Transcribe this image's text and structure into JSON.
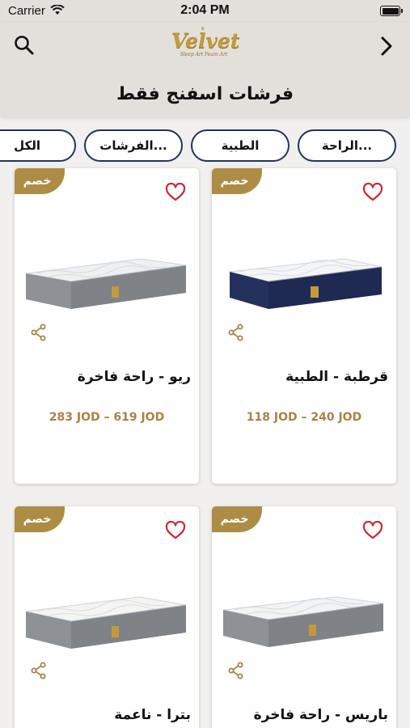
{
  "status_bar": {
    "carrier": "Carrier",
    "time": "2:04 PM"
  },
  "header": {
    "logo_text": "Velvet",
    "logo_tagline": "Sleep Art Feam Art",
    "title": "فرشات اسفنج فقط"
  },
  "filters": {
    "chips": [
      {
        "label": "الراحة..."
      },
      {
        "label": "الطبية"
      },
      {
        "label": "الفرشات..."
      },
      {
        "label": "الكل"
      }
    ]
  },
  "products": [
    {
      "badge": "خصم",
      "name": "قرطبة - الطبية",
      "price": "118 JOD – 240 JOD",
      "cover": "navy"
    },
    {
      "badge": "خصم",
      "name": "ريو - راحة فاخرة",
      "price": "283 JOD – 619 JOD",
      "cover": "grey"
    },
    {
      "badge": "خصم",
      "name": "باريس - راحة فاخرة",
      "price": "",
      "cover": "grey"
    },
    {
      "badge": "خصم",
      "name": "بترا - ناعمة",
      "price": "",
      "cover": "grey"
    }
  ],
  "colors": {
    "accent": "#ad8d45",
    "price": "#a38448",
    "chip_border": "#24315a",
    "heart": "#c92a35"
  },
  "icons": {
    "search": "search-icon",
    "back": "chevron-right-icon",
    "heart": "heart-icon",
    "share": "share-icon"
  }
}
